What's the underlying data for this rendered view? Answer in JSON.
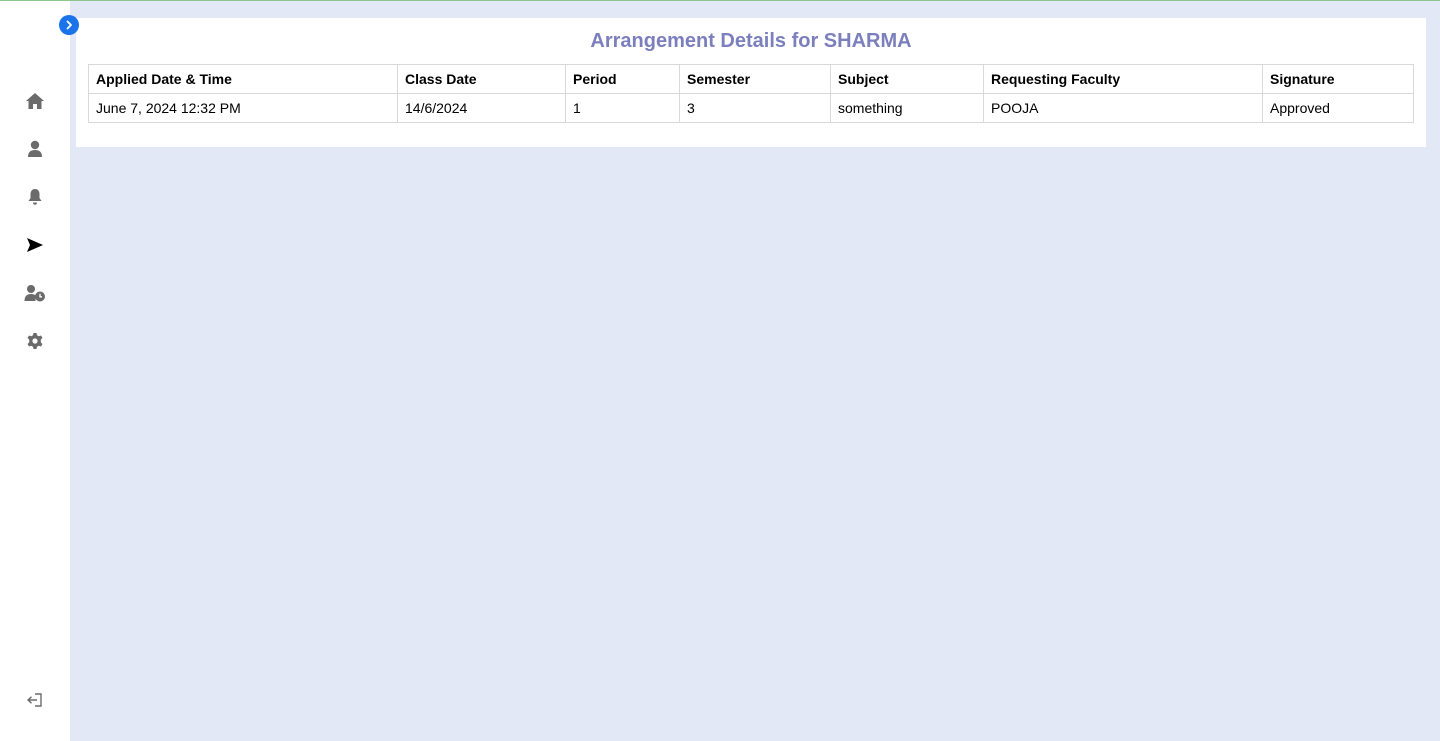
{
  "colors": {
    "accent": "#1a73e8",
    "title": "#7b7fbd",
    "icon": "#6b6b6b",
    "active_icon": "#000000",
    "background": "#e2e8f6"
  },
  "sidebar": {
    "items": [
      {
        "icon": "home-icon"
      },
      {
        "icon": "user-icon"
      },
      {
        "icon": "bell-icon"
      },
      {
        "icon": "send-icon",
        "active": true
      },
      {
        "icon": "user-clock-icon"
      },
      {
        "icon": "gear-icon"
      }
    ],
    "logout_icon": "logout-icon"
  },
  "page": {
    "title": "Arrangement Details for SHARMA"
  },
  "table": {
    "headers": [
      "Applied Date & Time",
      "Class Date",
      "Period",
      "Semester",
      "Subject",
      "Requesting Faculty",
      "Signature"
    ],
    "rows": [
      [
        "June 7, 2024 12:32 PM",
        "14/6/2024",
        "1",
        "3",
        "something",
        "POOJA",
        "Approved"
      ]
    ]
  }
}
